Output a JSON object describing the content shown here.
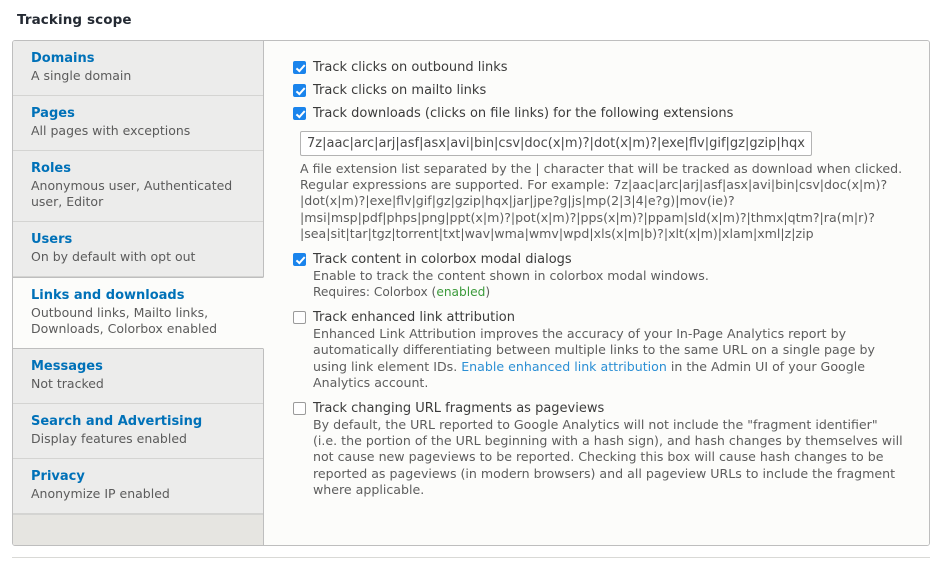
{
  "page": {
    "title": "Tracking scope"
  },
  "sidebar": {
    "items": [
      {
        "title": "Domains",
        "summary": "A single domain",
        "active": false
      },
      {
        "title": "Pages",
        "summary": "All pages with exceptions",
        "active": false
      },
      {
        "title": "Roles",
        "summary": "Anonymous user, Authenticated user, Editor",
        "active": false
      },
      {
        "title": "Users",
        "summary": "On by default with opt out",
        "active": false
      },
      {
        "title": "Links and downloads",
        "summary": "Outbound links, Mailto links, Downloads, Colorbox enabled",
        "active": true
      },
      {
        "title": "Messages",
        "summary": "Not tracked",
        "active": false
      },
      {
        "title": "Search and Advertising",
        "summary": "Display features enabled",
        "active": false
      },
      {
        "title": "Privacy",
        "summary": "Anonymize IP enabled",
        "active": false
      }
    ]
  },
  "content": {
    "outbound": {
      "label": "Track clicks on outbound links",
      "checked": true
    },
    "mailto": {
      "label": "Track clicks on mailto links",
      "checked": true
    },
    "downloads": {
      "label": "Track downloads (clicks on file links) for the following extensions",
      "checked": true,
      "input_value": "7z|aac|arc|arj|asf|asx|avi|bin|csv|doc(x|m)?|dot(x|m)?|exe|flv|gif|gz|gzip|hqx",
      "description": "A file extension list separated by the | character that will be tracked as download when clicked. Regular expressions are supported. For example: 7z|aac|arc|arj|asf|asx|avi|bin|csv|doc(x|m)?|dot(x|m)?|exe|flv|gif|gz|gzip|hqx|jar|jpe?g|js|mp(2|3|4|e?g)|mov(ie)?|msi|msp|pdf|phps|png|ppt(x|m)?|pot(x|m)?|pps(x|m)?|ppam|sld(x|m)?|thmx|qtm?|ra(m|r)?|sea|sit|tar|tgz|torrent|txt|wav|wma|wmv|wpd|xls(x|m|b)?|xlt(x|m)|xlam|xml|z|zip"
    },
    "colorbox": {
      "label": "Track content in colorbox modal dialogs",
      "checked": true,
      "description": "Enable to track the content shown in colorbox modal windows.",
      "requires_prefix": "Requires: Colorbox (",
      "requires_state": "enabled",
      "requires_suffix": ")"
    },
    "enhanced_link": {
      "label": "Track enhanced link attribution",
      "checked": false,
      "desc_part1": "Enhanced Link Attribution improves the accuracy of your In-Page Analytics report by automatically differentiating between multiple links to the same URL on a single page by using link element IDs. ",
      "link_text": "Enable enhanced link attribution",
      "desc_part2": " in the Admin UI of your Google Analytics account."
    },
    "url_fragments": {
      "label": "Track changing URL fragments as pageviews",
      "checked": false,
      "description": "By default, the URL reported to Google Analytics will not include the \"fragment identifier\" (i.e. the portion of the URL beginning with a hash sign), and hash changes by themselves will not cause new pageviews to be reported. Checking this box will cause hash changes to be reported as pageviews (in modern browsers) and all pageview URLs to include the fragment where applicable."
    }
  },
  "colors": {
    "link": "#0071b8",
    "checkbox_accent": "#1a84ec",
    "enabled_green": "#3b9a3b",
    "panel_border": "#bebebe"
  }
}
